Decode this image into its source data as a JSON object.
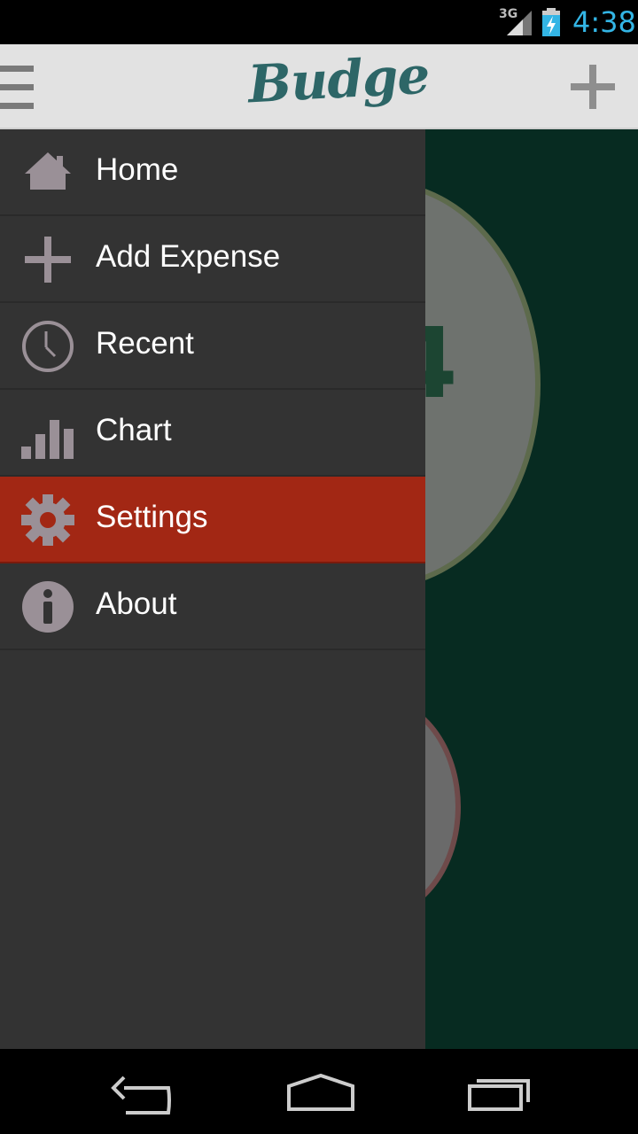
{
  "status_bar": {
    "network": "3G",
    "time": "4:38",
    "clock_color": "#33b5e5"
  },
  "action_bar": {
    "logo": "Budge",
    "menu_icon": "hamburger-icon",
    "add_icon": "plus-icon"
  },
  "background": {
    "circle_text": "4"
  },
  "drawer": {
    "items": [
      {
        "label": "Home",
        "icon": "home-icon"
      },
      {
        "label": "Add Expense",
        "icon": "plus-icon"
      },
      {
        "label": "Recent",
        "icon": "clock-icon"
      },
      {
        "label": "Chart",
        "icon": "bar-chart-icon"
      },
      {
        "label": "Settings",
        "icon": "gear-icon",
        "active": true
      },
      {
        "label": "About",
        "icon": "info-icon"
      }
    ],
    "active_color": "#a22714"
  },
  "nav_bar": {
    "back_icon": "back-icon",
    "home_icon": "home-nav-icon",
    "recents_icon": "recents-icon"
  }
}
